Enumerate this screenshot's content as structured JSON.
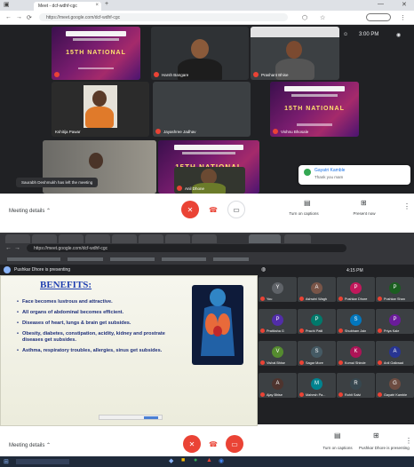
{
  "shot1": {
    "browser": {
      "tab_title": "Meet - dcf-wdhf-cgc",
      "address": "https://meet.google.com/dcf-wdhf-cgc",
      "minimize": "—",
      "close": "✕"
    },
    "meet_top": {
      "clock": "3:00 PM"
    },
    "slide_text": "15TH NATIONAL",
    "participants": [
      {
        "name": "Harsh Bangare"
      },
      {
        "name": "Prashant Bhise"
      },
      {
        "name": "Kshitija Pawar"
      },
      {
        "name": "Jayashree Jadhav"
      },
      {
        "name": "Vishnu Bhosale"
      },
      {
        "name": "Anil Dhone"
      }
    ],
    "toast": "Saurabh Deshmukh has left the meeting",
    "popup": {
      "name": "Gayatri Kamble",
      "sub": "Thank you mam"
    },
    "bottom_bar": {
      "meeting_details": "Meeting details",
      "captions_label": "Turn on captions",
      "present_label": "Present now"
    }
  },
  "shot2": {
    "browser": {
      "address": "https://meet.google.com/dcf-wdhf-cgc"
    },
    "presenting": "Pushkar Dhore is presenting",
    "slide": {
      "title": "BENEFITS:",
      "bullets": [
        "Face becomes lustrous and attractive.",
        "All organs of abdominal becomes efficient.",
        "Diseases of heart, lungs & brain get subsides.",
        "Obesity, diabetes, constipation, acidity, kidney and prostrate diseases get subsides.",
        "Asthma, respiratory troubles, allergies, sinus get subsides."
      ]
    },
    "clock": "4:15 PM",
    "grid": [
      {
        "name": "You",
        "initial": "Y",
        "color": "#5f6368"
      },
      {
        "name": "Ashwini Wagh",
        "initial": "A",
        "color": "#795548"
      },
      {
        "name": "Pushkar Dhore",
        "initial": "P",
        "color": "#c2185b"
      },
      {
        "name": "Pushkar Shan",
        "initial": "P",
        "color": "#1b5e20"
      },
      {
        "name": "Pratiksha G",
        "initial": "P",
        "color": "#512da8"
      },
      {
        "name": "Prachi Patil",
        "initial": "P",
        "color": "#00796b"
      },
      {
        "name": "Shubham Jain",
        "initial": "S",
        "color": "#0277bd"
      },
      {
        "name": "Priya Kale",
        "initial": "P",
        "color": "#6a1b9a"
      },
      {
        "name": "Vishal Bhise",
        "initial": "V",
        "color": "#558b2f"
      },
      {
        "name": "Sagar More",
        "initial": "S",
        "color": "#455a64"
      },
      {
        "name": "Komal Shinde",
        "initial": "K",
        "color": "#ad1457"
      },
      {
        "name": "Anil Gaikwad",
        "initial": "A",
        "color": "#283593"
      },
      {
        "name": "Ajay Bhise",
        "initial": "A",
        "color": "#4e342e"
      },
      {
        "name": "Mahesh Pa...",
        "initial": "M",
        "color": "#00838f"
      },
      {
        "name": "Rohit Salvi",
        "initial": "R",
        "color": "#37474f"
      },
      {
        "name": "Gayatri Kamble",
        "initial": "G",
        "color": "#6d4c41"
      }
    ],
    "bottom_bar": {
      "meeting_details": "Meeting details",
      "captions_label": "Turn on captions",
      "present_label": "Pushkar Dhore is presenting"
    }
  },
  "colors": {
    "meet_bg": "#202124",
    "red": "#ea4335",
    "slide_title": "#1f3fb0"
  }
}
